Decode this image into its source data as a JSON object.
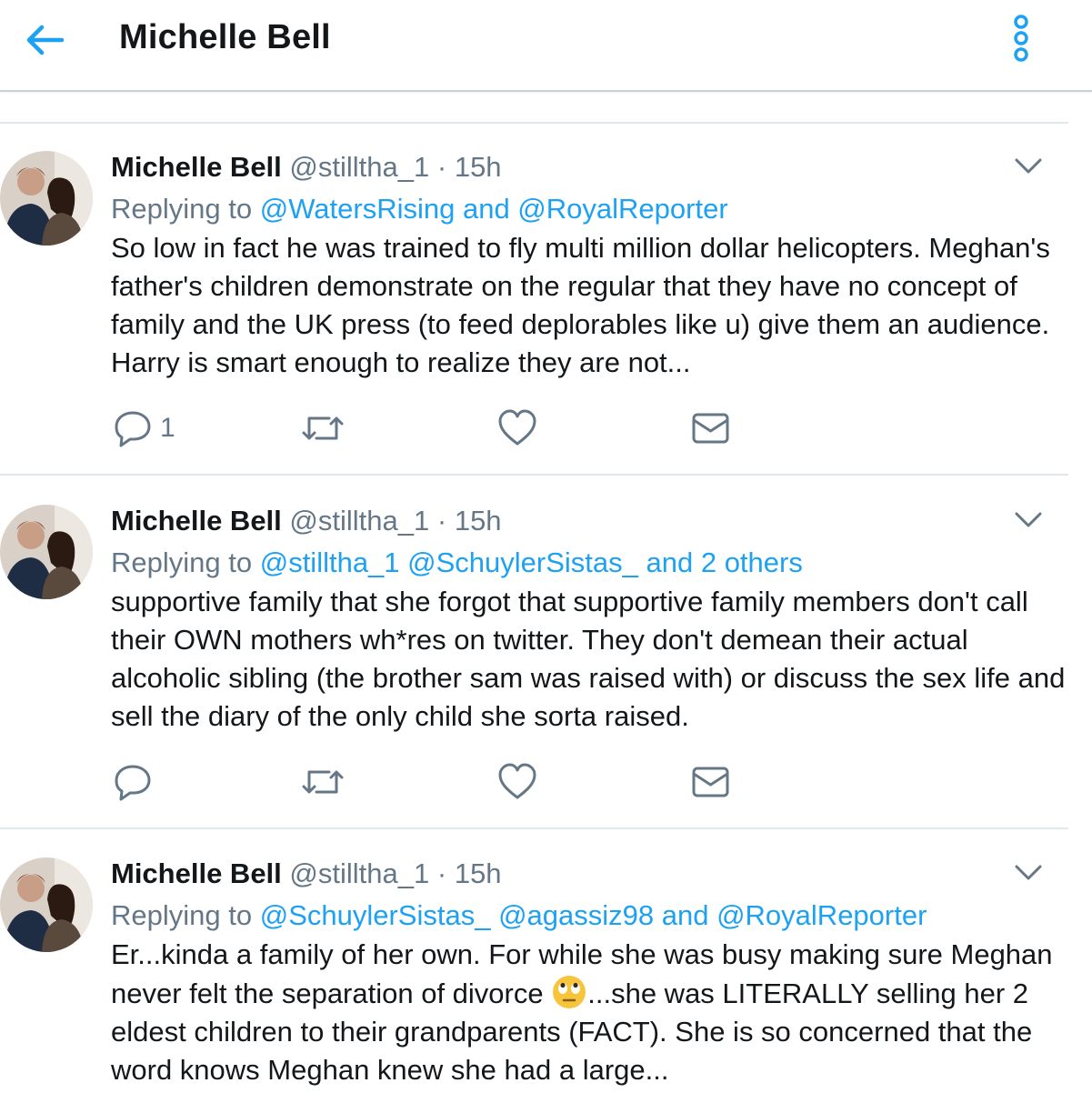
{
  "header": {
    "title": "Michelle Bell"
  },
  "tweets": [
    {
      "name": "Michelle Bell",
      "handle": "@stilltha_1",
      "separator": "·",
      "time": "15h",
      "replying_prefix": "Replying to",
      "replying_mentions": "@WatersRising and @RoyalReporter",
      "text": "So low in fact he was trained to fly multi million dollar helicopters. Meghan's father's children demonstrate on the regular that they have no concept of family and the UK press (to feed deplorables like u) give them an audience.  Harry is smart enough to realize they are not...",
      "reply_count": "1"
    },
    {
      "name": "Michelle Bell",
      "handle": "@stilltha_1",
      "separator": "·",
      "time": "15h",
      "replying_prefix": "Replying to",
      "replying_mentions": "@stilltha_1 @SchuylerSistas_ and 2 others",
      "text": "supportive family that she forgot that supportive family members don't call their OWN mothers wh*res on twitter. They don't demean their actual alcoholic sibling (the brother sam was raised with) or discuss the sex life and sell the diary of the only child she sorta raised.",
      "reply_count": ""
    },
    {
      "name": "Michelle Bell",
      "handle": "@stilltha_1",
      "separator": "·",
      "time": "15h",
      "replying_prefix": "Replying to",
      "replying_mentions": "@SchuylerSistas_ @agassiz98 and @RoyalReporter",
      "text_part1": "Er...kinda a family of her own. For while she was busy making sure Meghan never felt the separation of divorce",
      "emoji": "face-with-rolling-eyes",
      "text_part2": "...she was LITERALLY selling her 2 eldest children to their grandparents (FACT).  She is so concerned that the word knows Meghan knew she had a large...",
      "reply_count": ""
    }
  ],
  "colors": {
    "accent": "#1da1f2",
    "secondary_text": "#657786",
    "icon": "#657786",
    "divider": "#e1e8ed"
  }
}
